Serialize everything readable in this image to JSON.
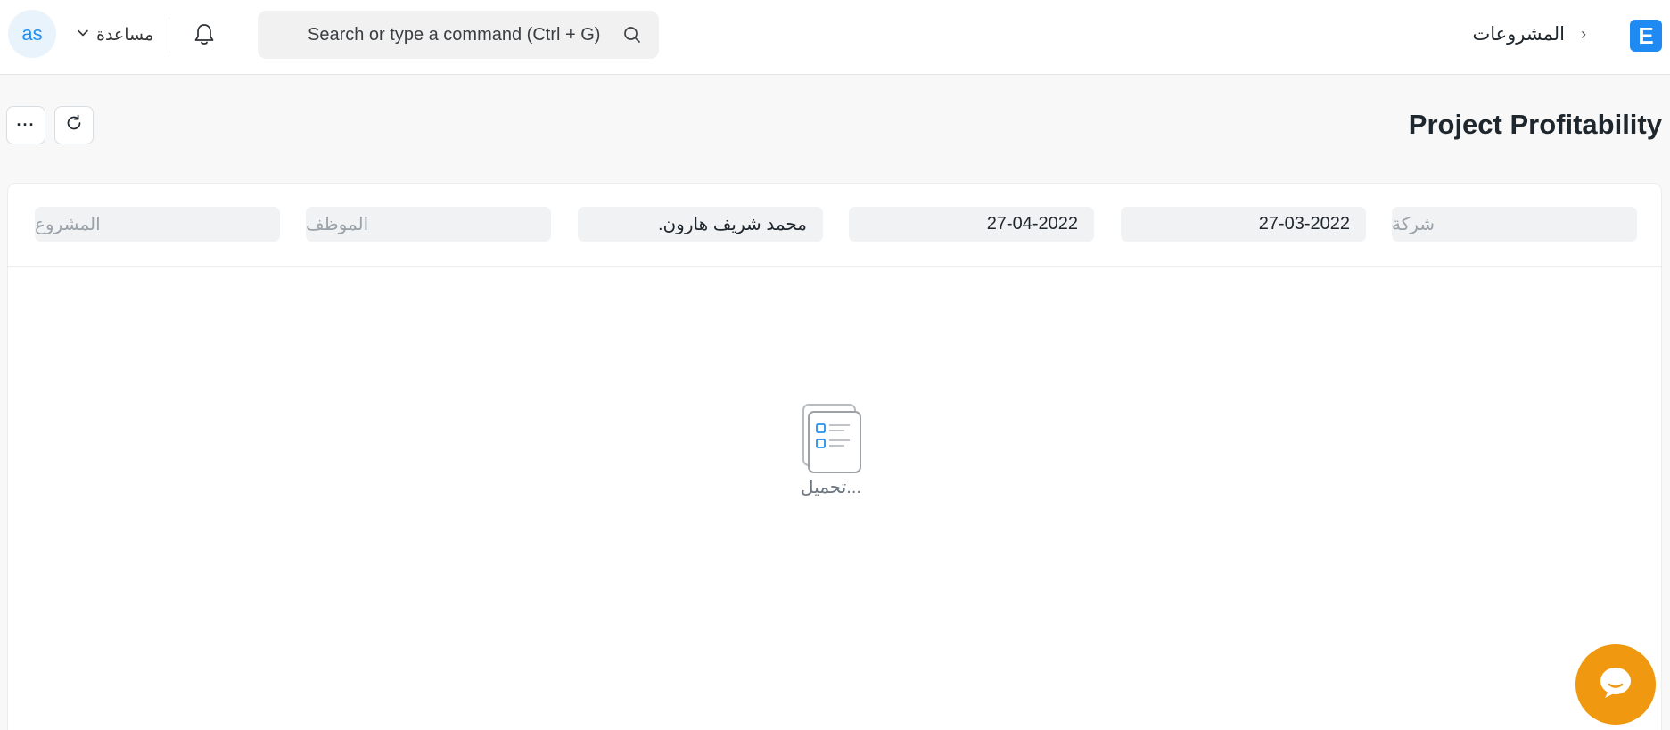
{
  "navbar": {
    "avatar_initials": "as",
    "help_label": "مساعدة",
    "search_placeholder": "Search or type a command (Ctrl + G)",
    "breadcrumb_module": "المشروعات",
    "breadcrumb_separator": "›",
    "logo_letter": "E"
  },
  "page": {
    "title": "Project Profitability",
    "more_label": "···"
  },
  "filters": [
    {
      "label": "المشروع",
      "value": "",
      "kind": "placeholder"
    },
    {
      "label": "الموظف",
      "value": "",
      "kind": "placeholder"
    },
    {
      "label": "",
      "value": "محمد شريف هارون.",
      "kind": "value"
    },
    {
      "label": "",
      "value": "27-04-2022",
      "kind": "value"
    },
    {
      "label": "",
      "value": "27-03-2022",
      "kind": "value"
    },
    {
      "label": "شركة",
      "value": "",
      "kind": "placeholder"
    }
  ],
  "report": {
    "loading_text": "تحميل..."
  },
  "colors": {
    "accent": "#2490ef",
    "logo": "#1e8af2",
    "chat": "#ef9810"
  },
  "icons": {
    "bell": "bell-icon",
    "search": "search-icon",
    "refresh": "refresh-icon",
    "chat": "chat-icon",
    "chevron": "chevron-down-icon",
    "loading": "report-placeholder-icon"
  }
}
